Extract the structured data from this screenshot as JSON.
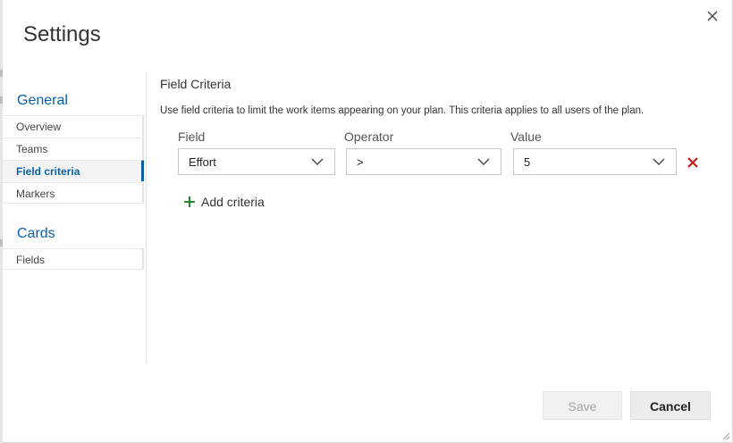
{
  "dialog": {
    "title": "Settings"
  },
  "sidebar": {
    "sections": [
      {
        "title": "General",
        "items": [
          {
            "label": "Overview"
          },
          {
            "label": "Teams"
          },
          {
            "label": "Field criteria",
            "selected": true
          },
          {
            "label": "Markers"
          }
        ]
      },
      {
        "title": "Cards",
        "items": [
          {
            "label": "Fields"
          }
        ]
      }
    ]
  },
  "panel": {
    "title": "Field Criteria",
    "description": "Use field criteria to limit the work items appearing on your plan. This criteria applies to all users of the plan.",
    "columns": {
      "field": "Field",
      "operator": "Operator",
      "value": "Value"
    },
    "criteria": [
      {
        "field": "Effort",
        "operator": ">",
        "value": "5"
      }
    ],
    "add_label": "Add criteria"
  },
  "footer": {
    "save_label": "Save",
    "cancel_label": "Cancel",
    "save_enabled": false
  },
  "icons": {
    "close": "close-icon",
    "chevron": "chevron-down-icon",
    "remove": "remove-icon",
    "add": "plus-icon",
    "resize": "resize-grip-icon"
  },
  "colors": {
    "accent": "#0a5fa8",
    "remove": "#c41e1e",
    "add": "#1f8a2a"
  }
}
